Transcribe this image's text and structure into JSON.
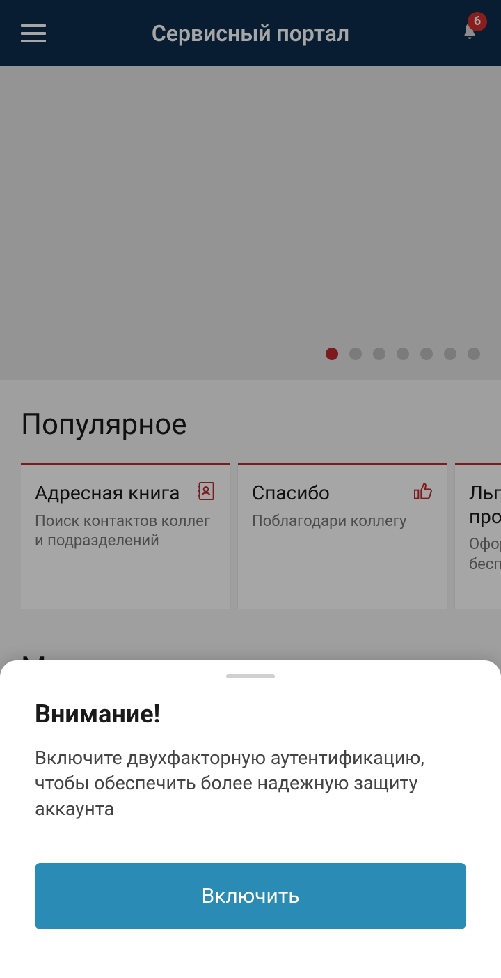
{
  "header": {
    "title": "Сервисный портал",
    "notification_count": "6"
  },
  "carousel": {
    "total_dots": 7,
    "active_index": 0
  },
  "popular": {
    "section_title": "Популярное",
    "cards": [
      {
        "title": "Адресная книга",
        "subtitle": "Поиск контактов коллег и подразделений",
        "icon": "address-book"
      },
      {
        "title": "Спасибо",
        "subtitle": "Поблагодари коллегу",
        "icon": "thumbs-up"
      },
      {
        "title": "Льготный проезд",
        "subtitle": "Оформление бесплатных поездок",
        "icon": "ticket"
      }
    ]
  },
  "services": {
    "section_title": "Мои сервисы"
  },
  "sheet": {
    "title": "Внимание!",
    "text": "Включите двухфакторную аутентификацию, чтобы обеспечить более надежную защиту аккаунта",
    "button": "Включить"
  }
}
